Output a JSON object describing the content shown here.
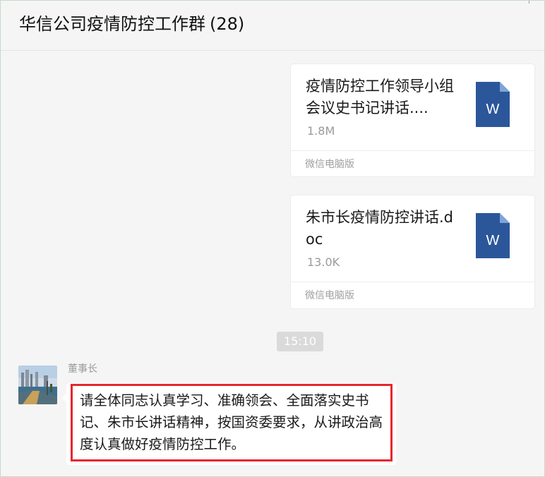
{
  "window": {
    "chat_title": "华信公司疫情防控工作群",
    "member_count": "(28)"
  },
  "messages": {
    "files": [
      {
        "name": "疫情防控工作领导小组会议史书记讲话....",
        "size": "1.8M",
        "source": "微信电脑版",
        "icon_letter": "W",
        "icon": "word-doc-icon"
      },
      {
        "name": "朱市长疫情防控讲话.doc",
        "size": "13.0K",
        "source": "微信电脑版",
        "icon_letter": "W",
        "icon": "word-doc-icon"
      }
    ],
    "timestamp": "15:10",
    "text_message": {
      "sender": "董事长",
      "text": "请全体同志认真学习、准确领会、全面落实史书记、朱市长讲话精神，按国资委要求，从讲政治高度认真做好疫情防控工作。"
    }
  },
  "colors": {
    "word_blue": "#2b579a",
    "highlight_red": "#e8262d",
    "chat_background": "#f5f5f5"
  }
}
